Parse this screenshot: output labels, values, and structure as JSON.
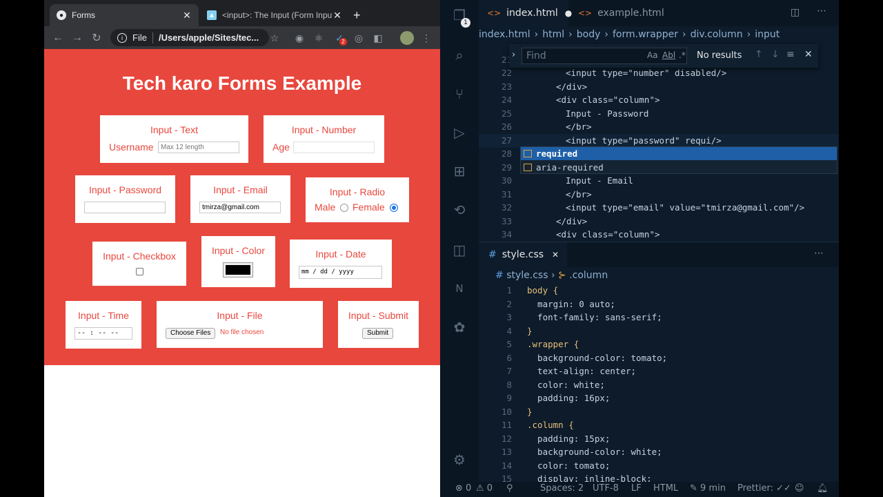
{
  "browser": {
    "tabs": [
      {
        "title": "Forms",
        "active": true
      },
      {
        "title": "<input>: The Input (Form Input",
        "active": false
      }
    ],
    "omnibox": {
      "scheme_label": "File",
      "url": "/Users/apple/Sites/tec..."
    },
    "extension_badge": "2"
  },
  "page": {
    "title": "Tech karo Forms Example",
    "columns": {
      "text": {
        "label": "Input - Text",
        "field_label": "Username",
        "placeholder": "Max 12 length"
      },
      "number": {
        "label": "Input - Number",
        "field_label": "Age"
      },
      "password": {
        "label": "Input - Password"
      },
      "email": {
        "label": "Input - Email",
        "value": "tmirza@gmail.com"
      },
      "radio": {
        "label": "Input - Radio",
        "option1": "Male",
        "option2": "Female",
        "selected": "Female"
      },
      "checkbox": {
        "label": "Input - Checkbox",
        "checked": false
      },
      "color": {
        "label": "Input - Color",
        "value": "#000000"
      },
      "date": {
        "label": "Input - Date",
        "placeholder": "mm / dd / yyyy"
      },
      "time": {
        "label": "Input - Time",
        "placeholder": "-- : --  --"
      },
      "file": {
        "label": "Input - File",
        "button": "Choose Files",
        "status": "No file chosen"
      },
      "submit": {
        "label": "Input - Submit",
        "button": "Submit"
      }
    }
  },
  "editor": {
    "tabs": [
      {
        "name": "index.html",
        "modified": true
      },
      {
        "name": "example.html"
      }
    ],
    "breadcrumbs": [
      "index.html",
      "html",
      "body",
      "form.wrapper",
      "div.column",
      "input"
    ],
    "find": {
      "placeholder": "Find",
      "result": "No results",
      "opt_case": "Aa",
      "opt_word": "Abl",
      "opt_regex": ".*"
    },
    "html_lines": [
      {
        "n": "21",
        "text": ""
      },
      {
        "n": "22",
        "text": "<input type=\"number\" disabled/>"
      },
      {
        "n": "23",
        "text": "</div>"
      },
      {
        "n": "24",
        "text": "<div class=\"column\">"
      },
      {
        "n": "25",
        "text": "Input - Password"
      },
      {
        "n": "26",
        "text": "</br>"
      },
      {
        "n": "27",
        "text": "<input type=\"password\" requi/>"
      },
      {
        "n": "28",
        "text": ""
      },
      {
        "n": "29",
        "text": ""
      },
      {
        "n": "30",
        "text": "Input - Email"
      },
      {
        "n": "31",
        "text": "</br>"
      },
      {
        "n": "32",
        "text": "<input type=\"email\" value=\"tmirza@gmail.com\"/>"
      },
      {
        "n": "33",
        "text": "</div>"
      },
      {
        "n": "34",
        "text": "<div class=\"column\">"
      }
    ],
    "suggestions": [
      "required",
      "aria-required"
    ],
    "css_tab": "style.css",
    "css_breadcrumbs": [
      "style.css",
      ".column"
    ],
    "css_lines": [
      {
        "n": "1",
        "text": "body {"
      },
      {
        "n": "2",
        "text": "  margin: 0 auto;"
      },
      {
        "n": "3",
        "text": "  font-family: sans-serif;"
      },
      {
        "n": "4",
        "text": "}"
      },
      {
        "n": "5",
        "text": ".wrapper {"
      },
      {
        "n": "6",
        "text": "  background-color: tomato;"
      },
      {
        "n": "7",
        "text": "  text-align: center;"
      },
      {
        "n": "8",
        "text": "  color: white;"
      },
      {
        "n": "9",
        "text": "  padding: 16px;"
      },
      {
        "n": "10",
        "text": "}"
      },
      {
        "n": "11",
        "text": ".column {"
      },
      {
        "n": "12",
        "text": "  padding: 15px;"
      },
      {
        "n": "13",
        "text": "  background-color: white;"
      },
      {
        "n": "14",
        "text": "  color: tomato;"
      },
      {
        "n": "15",
        "text": "  display: inline-block;"
      }
    ],
    "status": {
      "errors": "0",
      "warnings": "0",
      "spaces": "Spaces: 2",
      "encoding": "UTF-8",
      "eol": "LF",
      "language": "HTML",
      "time": "9 min",
      "formatter": "Prettier:"
    },
    "activity_badge": "1"
  },
  "colors": {
    "tomato": "#e8473d",
    "editor_bg": "#0d1b2a",
    "chrome_dark": "#202124"
  }
}
